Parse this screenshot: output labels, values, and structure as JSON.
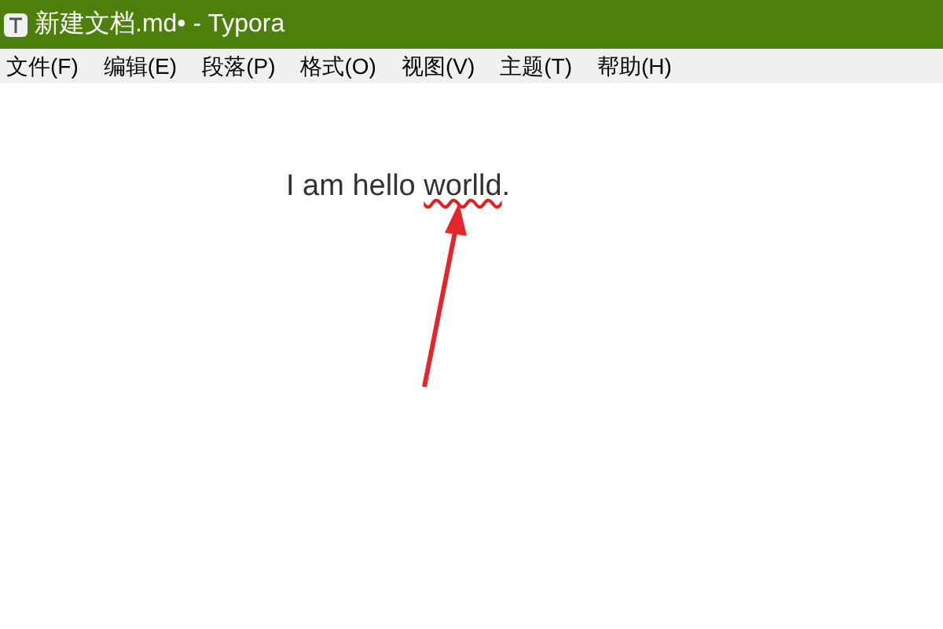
{
  "window": {
    "title": "新建文档.md• - Typora"
  },
  "menu": [
    {
      "label": "文件(F)"
    },
    {
      "label": "编辑(E)"
    },
    {
      "label": "段落(P)"
    },
    {
      "label": "格式(O)"
    },
    {
      "label": "视图(V)"
    },
    {
      "label": "主题(T)"
    },
    {
      "label": "帮助(H)"
    }
  ],
  "document": {
    "paragraph": [
      {
        "text": "I am hello ",
        "misspelled": false
      },
      {
        "text": "worlld",
        "misspelled": true
      },
      {
        "text": ".",
        "misspelled": false
      }
    ]
  }
}
